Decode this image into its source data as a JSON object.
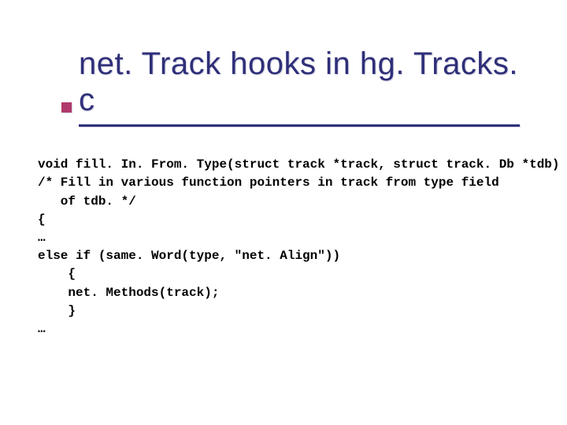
{
  "title": "net. Track hooks in hg. Tracks. c",
  "code": {
    "l0": "void fill. In. From. Type(struct track *track, struct track. Db *tdb)",
    "l1": "/* Fill in various function pointers in track from type field",
    "l2": "   of tdb. */",
    "l3": "{",
    "l4": "…",
    "l5": "else if (same. Word(type, \"net. Align\"))",
    "l6": "    {",
    "l7": "    net. Methods(track);",
    "l8": "    }",
    "l9": "…"
  }
}
